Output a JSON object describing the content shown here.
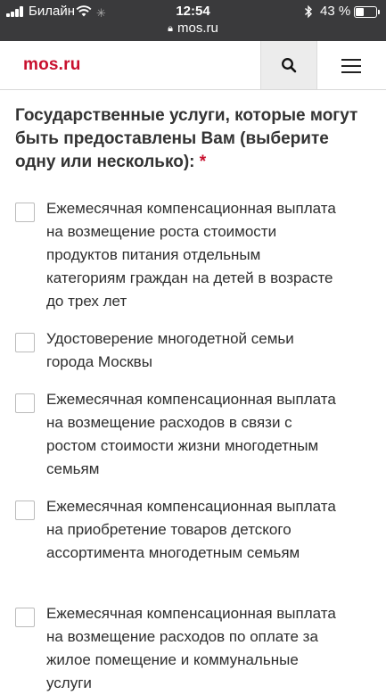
{
  "status_bar": {
    "carrier": "Билайн",
    "time": "12:54",
    "battery": "43 %",
    "url": "mos.ru",
    "icons": [
      "signal-icon",
      "wifi-icon",
      "loading-icon",
      "bluetooth-icon",
      "battery-icon",
      "lock-icon"
    ]
  },
  "header": {
    "logo": "mos.ru",
    "search_icon": "search-icon",
    "menu_icon": "hamburger-menu-icon"
  },
  "form": {
    "question": "Государственные услуги, которые могут быть предоставлены Вам (выберите одну или несколько):",
    "required_mark": "*",
    "options": [
      {
        "label": "Ежемесячная компенсационная выплата на возмещение роста стоимости продуктов питания отдельным категориям граждан на детей в возрасте до трех лет",
        "checked": false
      },
      {
        "label": "Удостоверение многодетной семьи города Москвы",
        "checked": false
      },
      {
        "label": "Ежемесячная компенсационная выплата на возмещение расходов в связи с ростом стоимости жизни многодетным семьям",
        "checked": false
      },
      {
        "label": "Ежемесячная компенсационная выплата на приобретение товаров детского ассортимента многодетным семьям",
        "checked": false
      },
      {
        "label": "Ежемесячная компенсационная выплата на возмещение расходов по оплате за жилое помещение и коммунальные услуги",
        "checked": false
      }
    ]
  },
  "colors": {
    "brand_red": "#c8102e",
    "status_bar_bg": "#3a3a3c"
  }
}
